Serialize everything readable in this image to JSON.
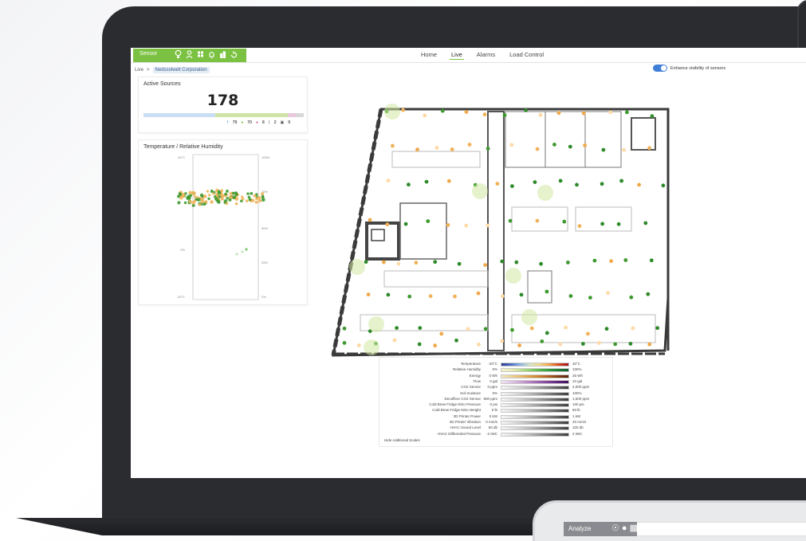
{
  "app": {
    "brand_label": "Sensor",
    "icons": [
      "lightbulb-icon",
      "person-badge-icon",
      "grid-icon",
      "bell-icon",
      "buildings-icon",
      "loop-icon"
    ],
    "accent_color": "#7cc242"
  },
  "nav": {
    "tabs": [
      {
        "label": "Home",
        "active": false
      },
      {
        "label": "Live",
        "active": true
      },
      {
        "label": "Alarms",
        "active": false
      },
      {
        "label": "Load Control",
        "active": false
      }
    ]
  },
  "breadcrumb": {
    "root": "Live",
    "separator": ">",
    "current": "Nedssolwell Corporation"
  },
  "toggle": {
    "label": "Enhance visibility of sensors",
    "on": true
  },
  "active_sources": {
    "title": "Active Sources",
    "count": "178",
    "segments": [
      {
        "color": "#c9dff3",
        "fraction": 0.45
      },
      {
        "color": "#cfe3a8",
        "fraction": 0.45
      },
      {
        "color": "#e9c8de",
        "fraction": 0.05
      },
      {
        "color": "#d8d8d8",
        "fraction": 0.05
      }
    ],
    "legend": [
      {
        "icon": "thermometer-icon",
        "value": "79"
      },
      {
        "icon": "drop-icon",
        "value": "70"
      },
      {
        "icon": "pink-dot-icon",
        "value": "8"
      },
      {
        "icon": "plug-icon",
        "value": "2"
      },
      {
        "icon": "meter-icon",
        "value": "9"
      }
    ]
  },
  "humidity_chart": {
    "title": "Temperature / Relative Humidity",
    "left_ticks": [
      "40°C",
      "0%",
      "-20°C"
    ],
    "right_ticks": [
      "100%",
      "75%",
      "50%",
      "25%",
      "0%"
    ]
  },
  "legend": {
    "rows": [
      {
        "name": "Temperature",
        "min": "-20°C",
        "max": "40°C",
        "palette": "temp"
      },
      {
        "name": "Relative Humidity",
        "min": "0%",
        "max": "100%",
        "palette": "humid"
      },
      {
        "name": "Energy",
        "min": "0 Wh",
        "max": "25 Wh",
        "palette": "energy"
      },
      {
        "name": "Flow",
        "min": "0 gal",
        "max": "10 gal",
        "palette": "flow"
      },
      {
        "name": "CO2 Sensor",
        "min": "0 ppm",
        "max": "2,000 ppm",
        "palette": "gray"
      },
      {
        "name": "Soil moisture",
        "min": "0%",
        "max": "100%",
        "palette": "gray"
      },
      {
        "name": "Decaffeur CO2 Sensor",
        "min": "500 ppm",
        "max": "1,500 ppm",
        "palette": "gray"
      },
      {
        "name": "Cold Brew Fridge Nitro Pressure",
        "min": "0 psi",
        "max": "100 psi",
        "palette": "gray"
      },
      {
        "name": "Cold Brew Fridge Nitro Weight",
        "min": "0 lb",
        "max": "60 lb",
        "palette": "gray"
      },
      {
        "name": "3D Printer Power",
        "min": "0 kW",
        "max": "1 kW",
        "palette": "gray"
      },
      {
        "name": "3D Printer Vibration",
        "min": "0 mm/s",
        "max": "20 mm/s",
        "palette": "gray"
      },
      {
        "name": "HVAC Sound Level",
        "min": "60 db",
        "max": "100 db",
        "palette": "gray"
      },
      {
        "name": "HVAC Differential Pressure",
        "min": "-2 IWC",
        "max": "2 IWC",
        "palette": "gray"
      }
    ],
    "footer": "Hide Additional Scales"
  },
  "tablet": {
    "brand_label": "Analyze"
  }
}
